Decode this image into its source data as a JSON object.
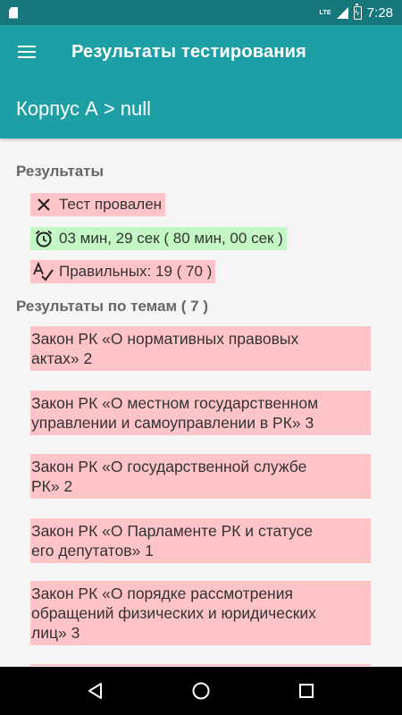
{
  "status_bar": {
    "time": "7:28",
    "network": "LTE"
  },
  "app_bar": {
    "title": "Результаты тестирования"
  },
  "sub_header": {
    "text": "Корпус А > null"
  },
  "results": {
    "title": "Результаты",
    "items": [
      {
        "icon": "close-icon",
        "text": "Тест провален",
        "status": "fail"
      },
      {
        "icon": "alarm-clock-icon",
        "text": "03 мин, 29 сек ( 80 мин, 00 сек )",
        "status": "ok"
      },
      {
        "icon": "spellcheck-icon",
        "text": "Правильных: 19 ( 70 )",
        "status": "fail"
      }
    ]
  },
  "topics": {
    "title": "Результаты по темам ( 7 )",
    "items": [
      {
        "line1": "Закон РК «О нормативных правовых",
        "line2": "актах» 2"
      },
      {
        "line1": "Закон РК «О местном государственном",
        "line2": "управлении и самоуправлении в РК» 3"
      },
      {
        "line1": "Закон РК «О государственной службе",
        "line2": "РК» 2"
      },
      {
        "line1": "Закон РК «О Парламенте РК и статусе",
        "line2": "его депутатов» 1"
      },
      {
        "line1": "Закон РК «О порядке рассмотрения",
        "line2": "обращений физических и юридических",
        "line3": "лиц» 3"
      }
    ]
  },
  "colors": {
    "primary": "#1e9fa6",
    "primary_dark": "#16777d",
    "fail_bg": "#ffc4c8",
    "ok_bg": "#c3f7c3"
  },
  "nav_bar": {
    "buttons": [
      "back",
      "home",
      "recents"
    ]
  }
}
